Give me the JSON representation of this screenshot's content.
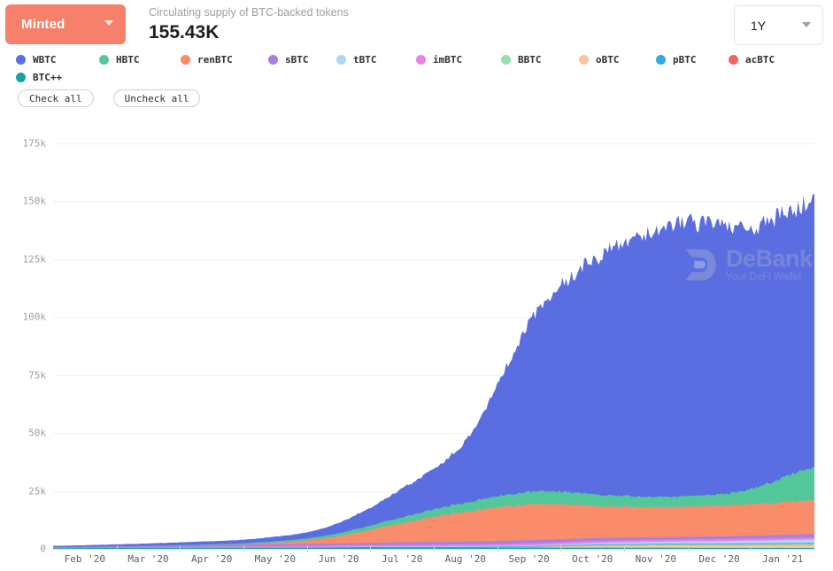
{
  "header": {
    "minted_label": "Minted",
    "minted_color": "#f6806a",
    "subtitle": "Circulating supply of BTC-backed tokens",
    "value": "155.43K",
    "range_label": "1Y",
    "caret_icon": "chevron-down-icon"
  },
  "legend": {
    "items": [
      {
        "label": "WBTC",
        "color": "#5b6ee1"
      },
      {
        "label": "HBTC",
        "color": "#54c79a"
      },
      {
        "label": "renBTC",
        "color": "#f98c6b"
      },
      {
        "label": "sBTC",
        "color": "#ab7fe0"
      },
      {
        "label": "tBTC",
        "color": "#aad8f7"
      },
      {
        "label": "imBTC",
        "color": "#ea82e6"
      },
      {
        "label": "BBTC",
        "color": "#96dfae"
      },
      {
        "label": "oBTC",
        "color": "#fbc39c"
      },
      {
        "label": "pBTC",
        "color": "#33aae3"
      },
      {
        "label": "acBTC",
        "color": "#f2655c"
      },
      {
        "label": "BTC++",
        "color": "#14a4a0"
      }
    ]
  },
  "controls": {
    "check_all": "Check all",
    "uncheck_all": "Uncheck all"
  },
  "watermark": {
    "name": "DeBank",
    "tagline": "Your DeFi Wallet"
  },
  "chart_data": {
    "type": "area",
    "stacked": true,
    "title": "Circulating supply of BTC-backed tokens",
    "xlabel": "",
    "ylabel": "",
    "ylim": [
      0,
      175000
    ],
    "yticks": [
      0,
      25000,
      50000,
      75000,
      100000,
      125000,
      150000,
      175000
    ],
    "ytick_labels": [
      "0",
      "25k",
      "50k",
      "75k",
      "100k",
      "125k",
      "150k",
      "175k"
    ],
    "grid": true,
    "legend_position": "top",
    "x": [
      "Feb '20",
      "Mar '20",
      "Apr '20",
      "May '20",
      "Jun '20",
      "Jul '20",
      "Aug '20",
      "Sep '20",
      "Oct '20",
      "Nov '20",
      "Dec '20",
      "Jan '21"
    ],
    "x_range": [
      "2020-02-01",
      "2021-01-31"
    ],
    "total_latest": 155430,
    "series": [
      {
        "name": "WBTC",
        "color": "#5b6ee1",
        "values": [
          600,
          900,
          1300,
          1800,
          3800,
          12000,
          28000,
          78000,
          105000,
          118000,
          113000,
          115000
        ]
      },
      {
        "name": "HBTC",
        "color": "#54c79a",
        "values": [
          0,
          0,
          200,
          600,
          1200,
          2500,
          4000,
          5500,
          4800,
          4500,
          6000,
          14000
        ]
      },
      {
        "name": "renBTC",
        "color": "#f98c6b",
        "values": [
          0,
          0,
          0,
          300,
          2500,
          8000,
          13000,
          15500,
          13500,
          13000,
          13500,
          14500
        ]
      },
      {
        "name": "sBTC",
        "color": "#ab7fe0",
        "values": [
          400,
          600,
          700,
          800,
          900,
          1100,
          1300,
          1400,
          1300,
          1200,
          1300,
          1500
        ]
      },
      {
        "name": "tBTC",
        "color": "#aad8f7",
        "values": [
          0,
          0,
          0,
          0,
          100,
          200,
          300,
          400,
          700,
          900,
          1100,
          1400
        ]
      },
      {
        "name": "imBTC",
        "color": "#ea82e6",
        "values": [
          0,
          100,
          300,
          500,
          600,
          700,
          750,
          800,
          800,
          800,
          800,
          850
        ]
      },
      {
        "name": "BBTC",
        "color": "#96dfae",
        "values": [
          0,
          0,
          0,
          0,
          0,
          0,
          0,
          100,
          200,
          300,
          350,
          400
        ]
      },
      {
        "name": "oBTC",
        "color": "#fbc39c",
        "values": [
          0,
          0,
          0,
          0,
          0,
          0,
          0,
          300,
          900,
          1100,
          1200,
          1300
        ]
      },
      {
        "name": "pBTC",
        "color": "#33aae3",
        "values": [
          0,
          0,
          50,
          100,
          150,
          200,
          250,
          300,
          300,
          300,
          320,
          350
        ]
      },
      {
        "name": "acBTC",
        "color": "#f2655c",
        "values": [
          0,
          0,
          0,
          0,
          0,
          0,
          0,
          0,
          50,
          80,
          100,
          130
        ]
      },
      {
        "name": "BTC++",
        "color": "#14a4a0",
        "values": [
          300,
          400,
          450,
          500,
          550,
          600,
          600,
          550,
          500,
          450,
          420,
          400
        ]
      }
    ]
  }
}
